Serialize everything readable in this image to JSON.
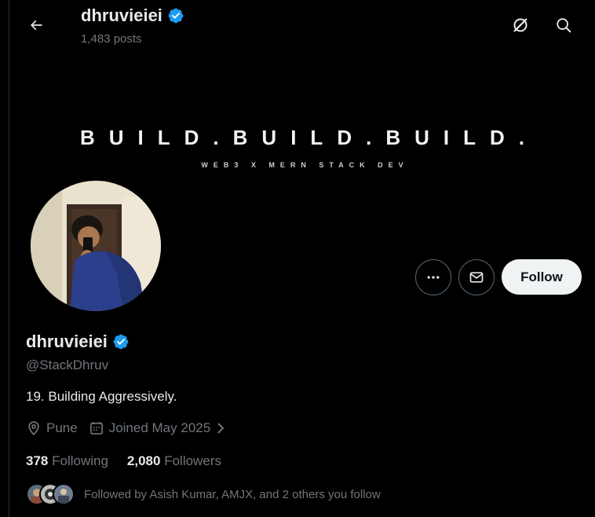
{
  "header": {
    "name": "dhruvieiei",
    "posts": "1,483 posts"
  },
  "banner": {
    "title": "BUILD.BUILD.BUILD.",
    "subtitle": "WEB3 X MERN STACK DEV"
  },
  "actions": {
    "follow_label": "Follow"
  },
  "profile": {
    "display_name": "dhruvieiei",
    "handle": "@StackDhruv",
    "bio": "19. Building Aggressively.",
    "location": "Pune",
    "joined": "Joined May 2025",
    "following_count": "378",
    "following_label": "Following",
    "followers_count": "2,080",
    "followers_label": "Followers",
    "followed_by": "Followed by Asish Kumar, AMJX, and 2 others you follow"
  },
  "icons": {
    "back": "arrow-left-icon",
    "grok": "grok-icon",
    "search": "search-icon",
    "more": "more-icon",
    "message": "mail-icon",
    "verified": "verified-badge-icon",
    "location": "location-pin-icon",
    "calendar": "calendar-icon"
  },
  "colors": {
    "verified": "#1d9bf0",
    "muted": "#71767b",
    "follow_bg": "#eff3f4"
  }
}
